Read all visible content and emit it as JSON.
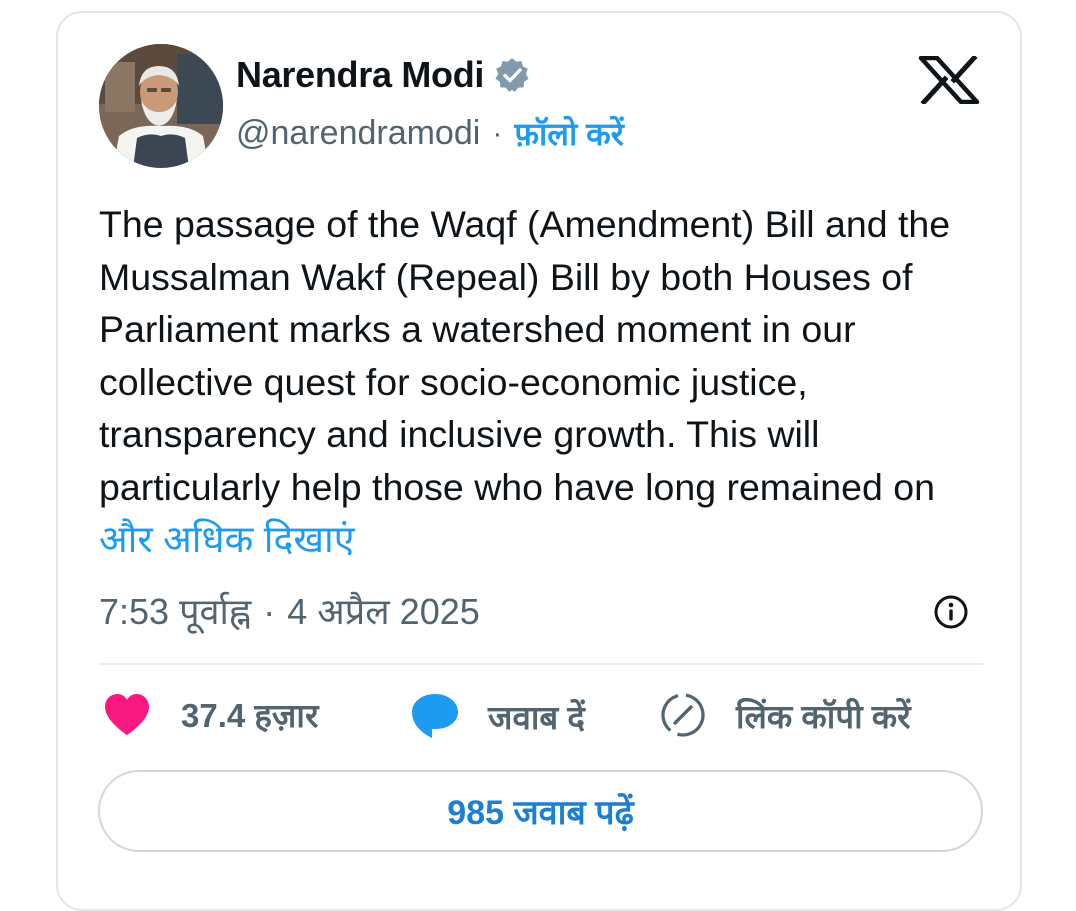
{
  "author": {
    "display_name": "Narendra Modi",
    "handle": "@narendramodi",
    "separator": "·",
    "follow_label": "फ़ॉलो करें",
    "verified": true
  },
  "platform_icon": "x-logo-icon",
  "tweet": {
    "text": "The passage of the Waqf (Amendment) Bill and the Mussalman Wakf (Repeal) Bill by both Houses of Parliament marks a watershed moment in our collective quest for socio-economic justice, transparency and inclusive growth. This will particularly help those who have long remained on",
    "show_more_label": "और अधिक दिखाएं"
  },
  "timestamp": {
    "time": "7:53 पूर्वाह्न",
    "separator": "·",
    "date": "4 अप्रैल 2025"
  },
  "actions": {
    "like_count": "37.4 हज़ार",
    "reply_label": "जवाब दें",
    "copy_link_label": "लिंक कॉपी करें"
  },
  "read_replies_label": "985 जवाब पढ़ें",
  "colors": {
    "accent": "#1d9bf0",
    "heart": "#f91880",
    "text": "#0f1419",
    "muted": "#536471",
    "verified_badge": "#829aab"
  }
}
